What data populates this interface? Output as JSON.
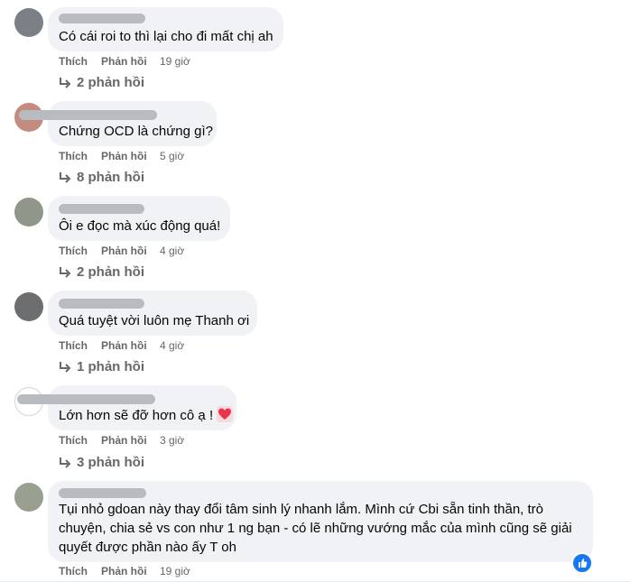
{
  "comments": [
    {
      "text": "Có cái roi to thì lại cho đi mất chị ah",
      "actions": {
        "like": "Thích",
        "reply": "Phản hồi",
        "time": "19 giờ"
      },
      "replies": "2 phản hồi"
    },
    {
      "text": "Chứng OCD là chứng gì?",
      "actions": {
        "like": "Thích",
        "reply": "Phản hồi",
        "time": "5 giờ"
      },
      "replies": "8 phản hồi"
    },
    {
      "text": "Ôi e đọc mà xúc động quá!",
      "actions": {
        "like": "Thích",
        "reply": "Phản hồi",
        "time": "4 giờ"
      },
      "replies": "2 phản hồi"
    },
    {
      "text": "Quá tuyệt vời luôn mẹ Thanh ơi",
      "actions": {
        "like": "Thích",
        "reply": "Phản hồi",
        "time": "4 giờ"
      },
      "replies": "1 phản hồi"
    },
    {
      "text": "Lớn hơn sẽ đỡ hơn cô ạ !",
      "actions": {
        "like": "Thích",
        "reply": "Phản hồi",
        "time": "3 giờ"
      },
      "replies": "3 phản hồi"
    },
    {
      "text": "Tụi nhỏ gdoan này thay đổi tâm sinh lý nhanh lắm. Mình cứ Cbi sẵn tinh thần, trò chuyện, chia sẻ vs con như 1 ng bạn - có lẽ những vướng mắc của mình cũng sẽ giải quyết được phần nào ấy T oh",
      "actions": {
        "like": "Thích",
        "reply": "Phản hồi",
        "time": "19 giờ"
      }
    }
  ],
  "icons": {
    "reply_arrow": "reply-arrow-icon",
    "heart_emoji": "heart-emoji-icon",
    "like_reaction": "like-reaction-icon"
  },
  "colors": {
    "bubble": "#f0f2f5",
    "secondary_text": "#65676b",
    "like_blue": "#1877f2"
  }
}
